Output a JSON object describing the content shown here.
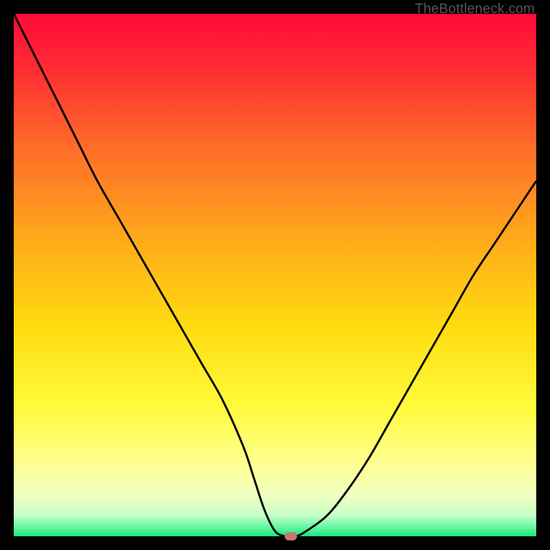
{
  "watermark": "TheBottleneck.com",
  "colors": {
    "top": "#ff0040",
    "upper": "#ff6a2a",
    "mid": "#ffd21a",
    "lower": "#ffff66",
    "pale": "#eaffc8",
    "bottom": "#1ef08a",
    "curve": "#000000",
    "marker": "#c97871",
    "frame": "#000000"
  },
  "chart_data": {
    "type": "line",
    "title": "",
    "xlabel": "",
    "ylabel": "",
    "xlim": [
      0,
      100
    ],
    "ylim": [
      0,
      100
    ],
    "x": [
      0,
      4,
      8,
      12,
      16,
      20,
      24,
      28,
      32,
      36,
      40,
      44,
      46,
      48,
      50,
      52,
      54,
      56,
      60,
      64,
      68,
      72,
      76,
      80,
      84,
      88,
      92,
      96,
      100
    ],
    "y": [
      100,
      92,
      84,
      76,
      68,
      61,
      54,
      47,
      40,
      33,
      26,
      17,
      11,
      5,
      1,
      0,
      0,
      1,
      4,
      9,
      15,
      22,
      29,
      36,
      43,
      50,
      56,
      62,
      68
    ],
    "marker": {
      "x": 53,
      "y": 0
    },
    "annotations": []
  }
}
